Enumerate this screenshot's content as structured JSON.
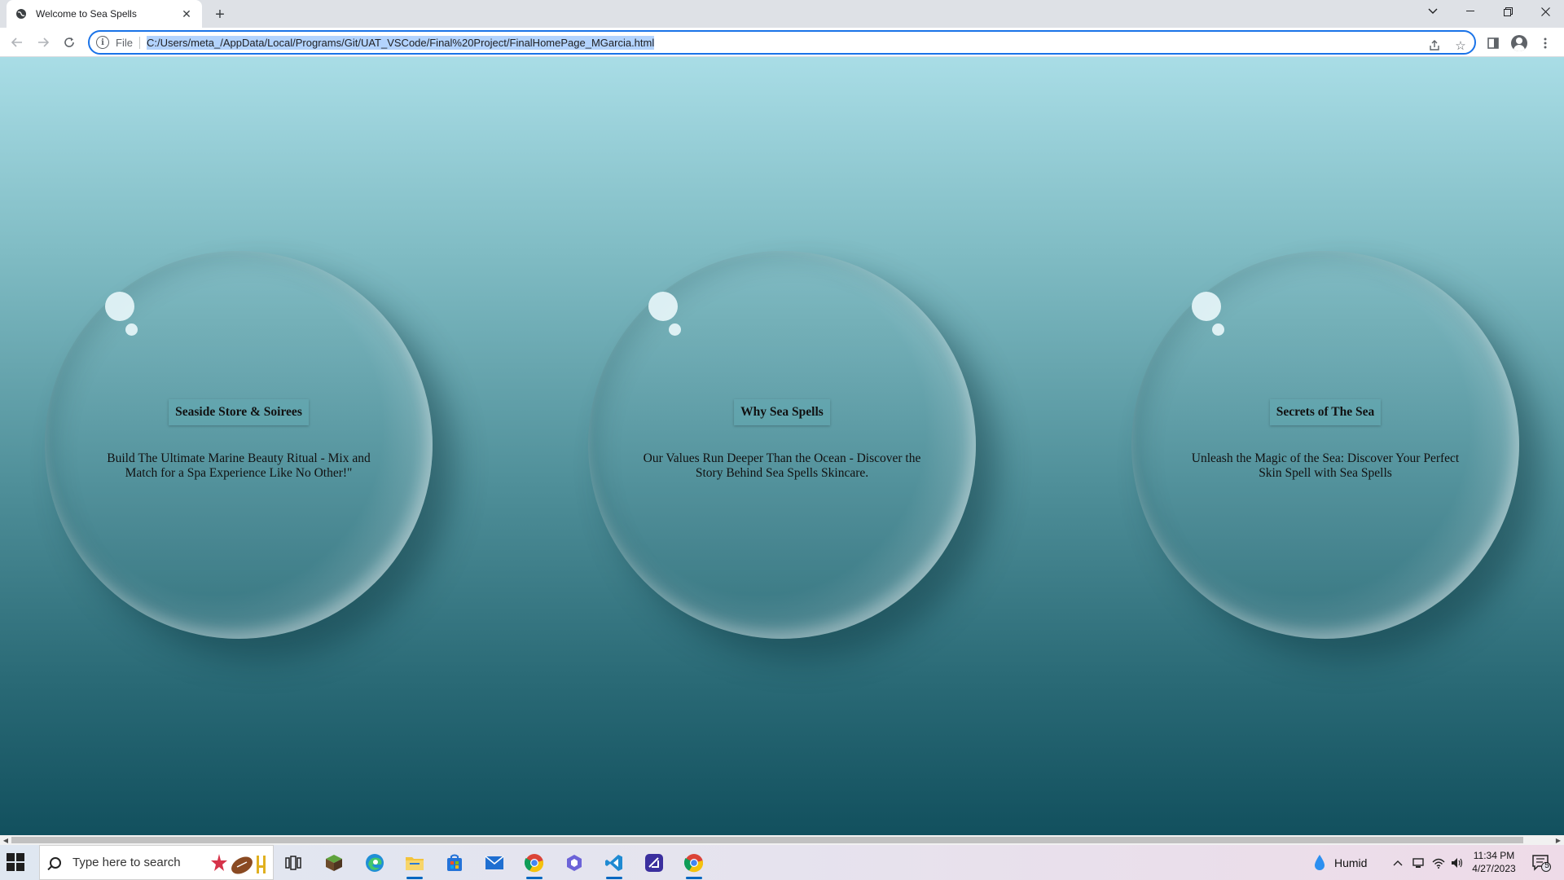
{
  "browser": {
    "tab_title": "Welcome to Sea Spells",
    "scheme_label": "File",
    "url": "C:/Users/meta_/AppData/Local/Programs/Git/UAT_VSCode/Final%20Project/FinalHomePage_MGarcia.html"
  },
  "bubbles": [
    {
      "heading": "Seaside Store & Soirees",
      "text": "Build The Ultimate Marine Beauty Ritual - Mix and Match for a Spa Experience Like No Other!\""
    },
    {
      "heading": "Why Sea Spells",
      "text": "Our Values Run Deeper Than the Ocean - Discover the Story Behind Sea Spells Skincare."
    },
    {
      "heading": "Secrets of The Sea",
      "text": "Unleash the Magic of the Sea: Discover Your Perfect Skin Spell with Sea Spells"
    }
  ],
  "taskbar": {
    "search_placeholder": "Type here to search",
    "weather": "Humid",
    "time": "11:34 PM",
    "date": "4/27/2023",
    "notification_count": "5"
  },
  "colors": {
    "accent": "#1a73e8",
    "sky_top": "#a9dde6",
    "sea_bottom": "#12505e"
  }
}
